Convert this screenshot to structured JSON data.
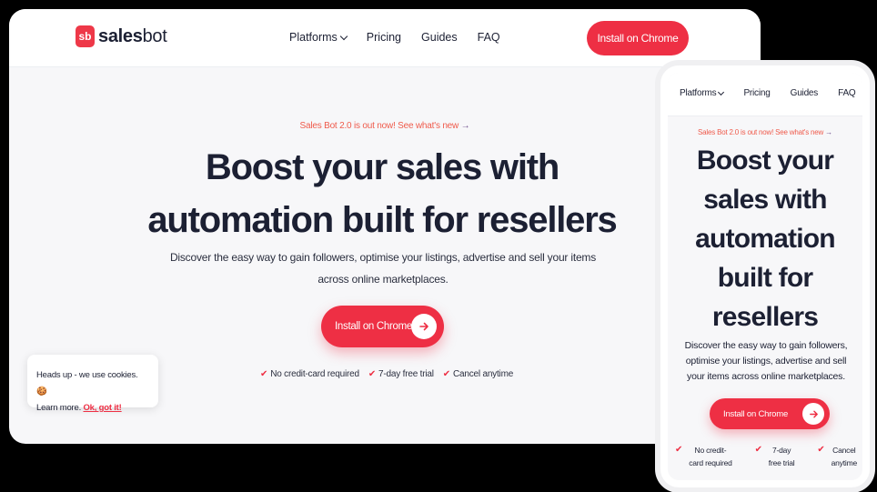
{
  "colors": {
    "brand_red": "#ee2f44",
    "accent_orange": "#ef5b4c",
    "dark_text": "#1c2033"
  },
  "brand": {
    "mark": "sb",
    "name_prefix": "sales",
    "name_suffix": "bot"
  },
  "desktop": {
    "nav": {
      "links": [
        {
          "label": "Platforms",
          "icon": "chevron-down-icon"
        },
        {
          "label": "Pricing"
        },
        {
          "label": "Guides"
        },
        {
          "label": "FAQ"
        }
      ],
      "cta_label": "Install on Chrome"
    },
    "announcement": "Sales Bot 2.0 is out now! See what's new",
    "headline_line1": "Boost your sales with",
    "headline_line2": "automation built for resellers",
    "subtext_line1": "Discover the easy way to gain followers, optimise your listings, advertise and sell your items",
    "subtext_line2": "across online marketplaces.",
    "cta_label": "Install on Chrome",
    "features": [
      "No credit-card required",
      "7-day free trial",
      "Cancel anytime"
    ],
    "cookie": {
      "text": "Heads up - we use cookies. 🍪",
      "learn_more": "Learn more.",
      "accept": "Ok, got it!"
    }
  },
  "mobile": {
    "nav": {
      "links": [
        {
          "label": "Platforms",
          "icon": "chevron-down-icon"
        },
        {
          "label": "Pricing"
        },
        {
          "label": "Guides"
        },
        {
          "label": "FAQ"
        }
      ]
    },
    "announcement": "Sales Bot 2.0 is out now! See what's new",
    "headline": [
      "Boost your",
      "sales with",
      "automation",
      "built for",
      "resellers"
    ],
    "subtext": [
      "Discover the easy way to gain followers,",
      "optimise your listings, advertise and sell",
      "your items across online marketplaces."
    ],
    "cta_label": "Install on Chrome",
    "features": [
      {
        "line1": "No credit-",
        "line2": "card required"
      },
      {
        "line1": "7-day",
        "line2": "free trial"
      },
      {
        "line1": "Cancel",
        "line2": "anytime"
      }
    ]
  }
}
